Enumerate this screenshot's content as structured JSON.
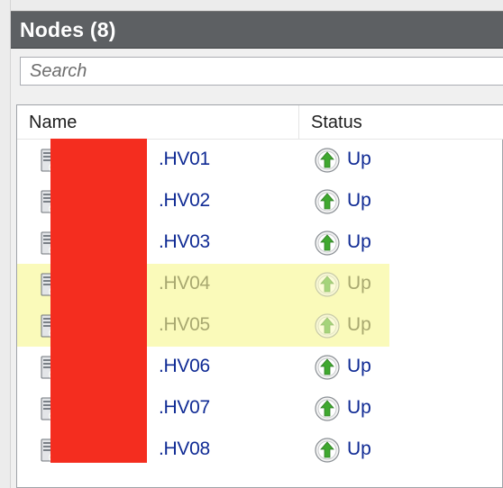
{
  "panel": {
    "title": "Nodes (8)"
  },
  "search": {
    "placeholder": "Search"
  },
  "columns": {
    "name": "Name",
    "status": "Status"
  },
  "nodes": [
    {
      "name": ".HV01",
      "status": "Up",
      "highlighted": false
    },
    {
      "name": ".HV02",
      "status": "Up",
      "highlighted": false
    },
    {
      "name": ".HV03",
      "status": "Up",
      "highlighted": false
    },
    {
      "name": ".HV04",
      "status": "Up",
      "highlighted": true
    },
    {
      "name": ".HV05",
      "status": "Up",
      "highlighted": true
    },
    {
      "name": ".HV06",
      "status": "Up",
      "highlighted": false
    },
    {
      "name": ".HV07",
      "status": "Up",
      "highlighted": false
    },
    {
      "name": ".HV08",
      "status": "Up",
      "highlighted": false
    }
  ],
  "icons": {
    "node": "server-node-icon",
    "status_up": "up-arrow-circle-icon"
  },
  "colors": {
    "header_bg": "#5d6063",
    "link_text": "#0f2a94",
    "highlight_bg": "#fafaba",
    "status_up_green": "#3fa82f",
    "redaction": "#f42d1f"
  }
}
